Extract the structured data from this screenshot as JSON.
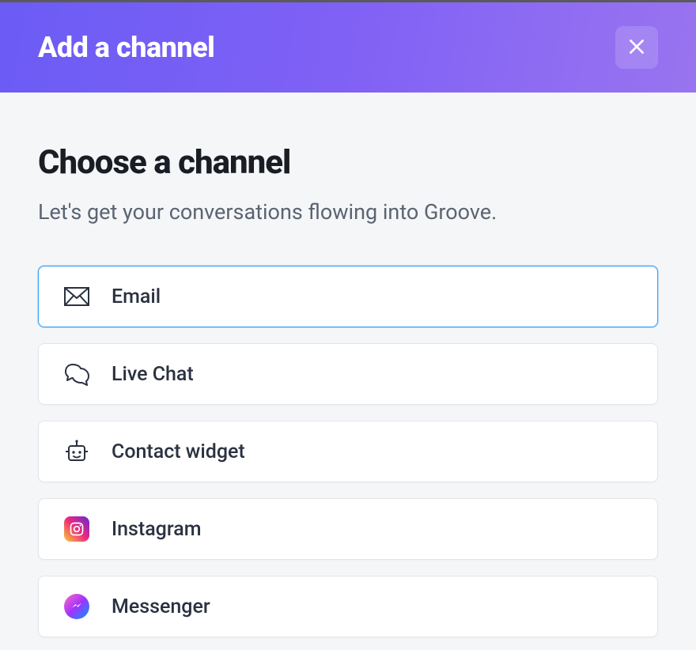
{
  "header": {
    "title": "Add a channel"
  },
  "main": {
    "heading": "Choose a channel",
    "subheading": "Let's get your conversations flowing into Groove."
  },
  "channels": [
    {
      "id": "email",
      "label": "Email",
      "selected": true
    },
    {
      "id": "livechat",
      "label": "Live Chat",
      "selected": false
    },
    {
      "id": "contact",
      "label": "Contact widget",
      "selected": false
    },
    {
      "id": "instagram",
      "label": "Instagram",
      "selected": false
    },
    {
      "id": "messenger",
      "label": "Messenger",
      "selected": false
    }
  ],
  "colors": {
    "accent": "#2f9cf4",
    "header_gradient_start": "#6b5cf5",
    "header_gradient_end": "#9974f0"
  }
}
